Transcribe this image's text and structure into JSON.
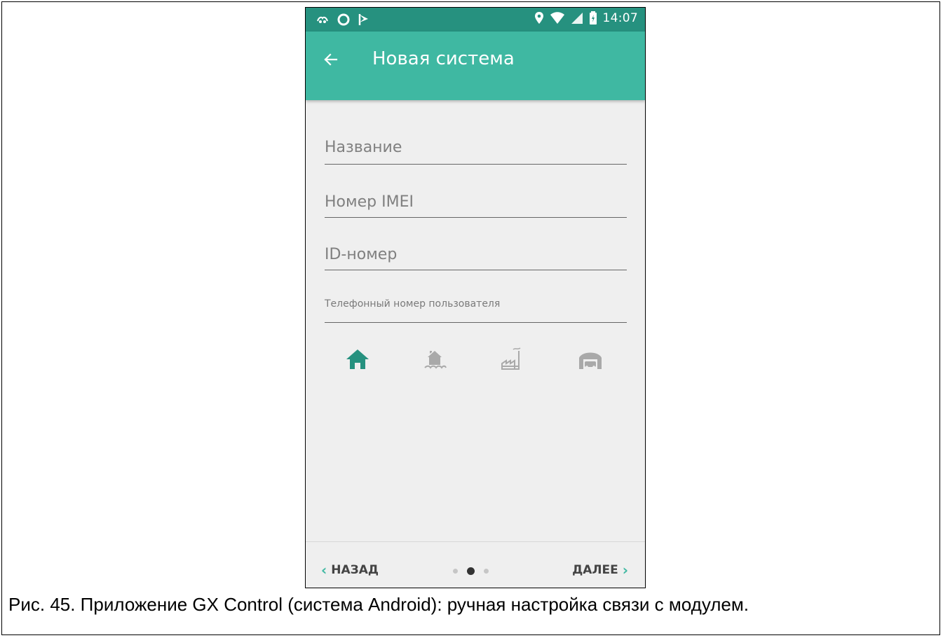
{
  "statusbar": {
    "time": "14:07",
    "left_icons": [
      "cell-alert-icon",
      "circle-icon",
      "flag-icon"
    ],
    "right_icons": [
      "location-pin-icon",
      "wifi-icon",
      "signal-icon",
      "battery-icon"
    ]
  },
  "appbar": {
    "title": "Новая система",
    "back_icon": "arrow-left-icon",
    "color": "#3fb8a2",
    "status_color": "#26917f"
  },
  "form": {
    "name_placeholder": "Название",
    "imei_placeholder": "Номер IMEI",
    "id_placeholder": "ID-номер",
    "phone_placeholder": "Телефонный номер пользователя"
  },
  "system_types": [
    {
      "icon": "house-icon",
      "selected": true
    },
    {
      "icon": "lake-house-icon",
      "selected": false
    },
    {
      "icon": "factory-icon",
      "selected": false
    },
    {
      "icon": "garage-icon",
      "selected": false
    }
  ],
  "bottom_nav": {
    "back_label": "НАЗАД",
    "next_label": "ДАЛЕЕ",
    "pages": 3,
    "current_page": 2
  },
  "caption": "Рис. 45. Приложение GX Control (система Android): ручная настройка связи с модулем."
}
